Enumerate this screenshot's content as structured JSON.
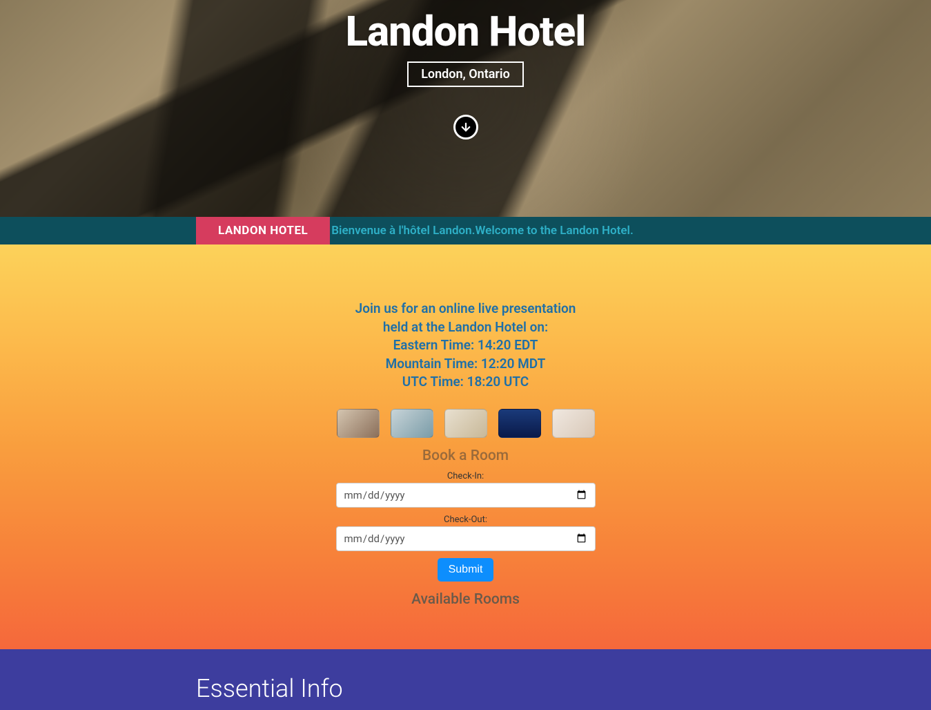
{
  "hero": {
    "title": "Landon Hotel",
    "subtitle": "London, Ontario"
  },
  "banner": {
    "label": "LANDON HOTEL",
    "welcome_fr": "Bienvenue à l'hôtel Landon.",
    "welcome_en": "Welcome to the Landon Hotel."
  },
  "presentation": {
    "line1": "Join us for an online live presentation",
    "line2": "held at the Landon Hotel on:",
    "eastern": "Eastern Time: 14:20 EDT",
    "mountain": "Mountain Time: 12:20 MDT",
    "utc": "UTC Time: 18:20 UTC"
  },
  "booking": {
    "heading": "Book a Room",
    "checkin_label": "Check-In:",
    "checkout_label": "Check-Out:",
    "date_placeholder": "mm/dd/yyyy",
    "submit_label": "Submit",
    "rooms_heading": "Available Rooms"
  },
  "footer": {
    "heading": "Essential Info"
  }
}
